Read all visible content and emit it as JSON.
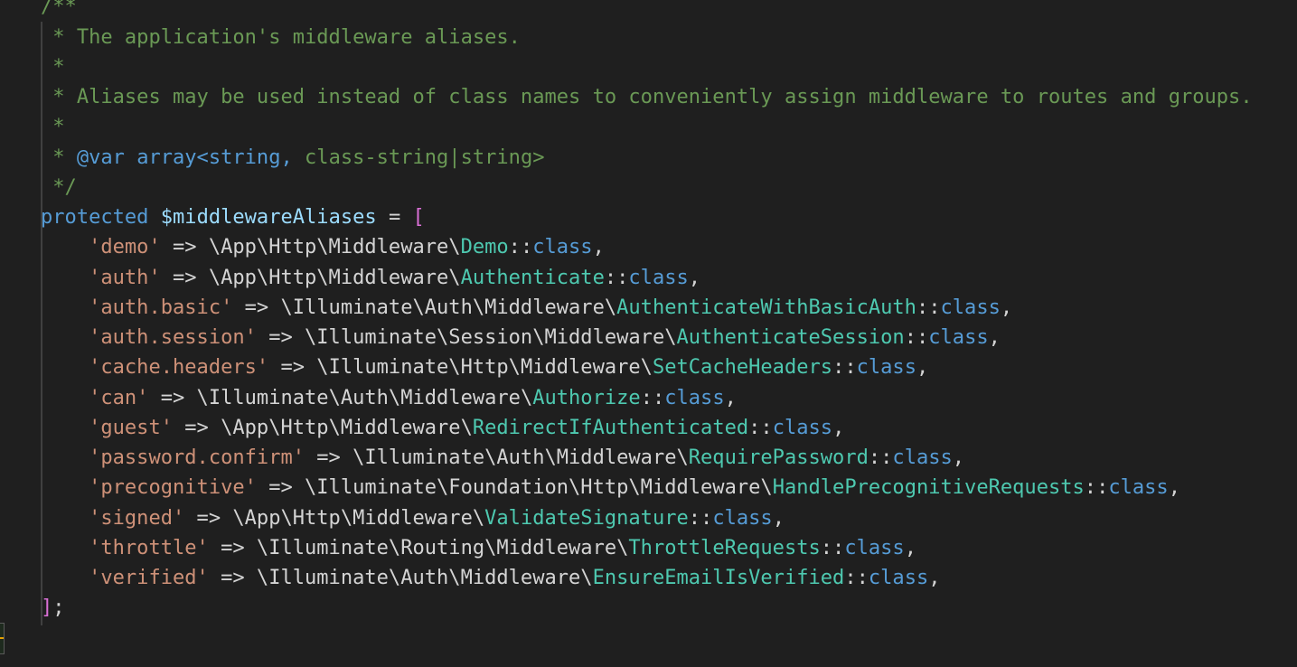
{
  "editor": {
    "lines": [
      {
        "tokens": [
          {
            "t": "/**",
            "c": "comment"
          }
        ]
      },
      {
        "tokens": [
          {
            "t": " * The application's middleware aliases.",
            "c": "comment"
          }
        ]
      },
      {
        "tokens": [
          {
            "t": " *",
            "c": "comment"
          }
        ]
      },
      {
        "tokens": [
          {
            "t": " * Aliases may be used instead of class names to conveniently assign middleware to routes and groups.",
            "c": "comment"
          }
        ]
      },
      {
        "tokens": [
          {
            "t": " *",
            "c": "comment"
          }
        ]
      },
      {
        "tokens": [
          {
            "t": " * ",
            "c": "comment"
          },
          {
            "t": "@var array<string,",
            "c": "doctag"
          },
          {
            "t": " class-string|string>",
            "c": "comment"
          }
        ]
      },
      {
        "tokens": [
          {
            "t": " */",
            "c": "comment"
          }
        ]
      },
      {
        "tokens": [
          {
            "t": "protected",
            "c": "keyword"
          },
          {
            "t": " ",
            "c": "plain"
          },
          {
            "t": "$middlewareAliases",
            "c": "variable"
          },
          {
            "t": " = ",
            "c": "operator"
          },
          {
            "t": "[",
            "c": "bracket"
          }
        ]
      },
      {
        "tokens": [
          {
            "t": "    'demo'",
            "c": "string"
          },
          {
            "t": " => \\App\\Http\\Middleware\\",
            "c": "namespace"
          },
          {
            "t": "Demo",
            "c": "classname"
          },
          {
            "t": "::",
            "c": "plain"
          },
          {
            "t": "class",
            "c": "classkw"
          },
          {
            "t": ",",
            "c": "plain"
          }
        ]
      },
      {
        "tokens": [
          {
            "t": "    'auth'",
            "c": "string"
          },
          {
            "t": " => \\App\\Http\\Middleware\\",
            "c": "namespace"
          },
          {
            "t": "Authenticate",
            "c": "classname"
          },
          {
            "t": "::",
            "c": "plain"
          },
          {
            "t": "class",
            "c": "classkw"
          },
          {
            "t": ",",
            "c": "plain"
          }
        ]
      },
      {
        "tokens": [
          {
            "t": "    'auth.basic'",
            "c": "string"
          },
          {
            "t": " => \\Illuminate\\Auth\\Middleware\\",
            "c": "namespace"
          },
          {
            "t": "AuthenticateWithBasicAuth",
            "c": "classname"
          },
          {
            "t": "::",
            "c": "plain"
          },
          {
            "t": "class",
            "c": "classkw"
          },
          {
            "t": ",",
            "c": "plain"
          }
        ]
      },
      {
        "tokens": [
          {
            "t": "    'auth.session'",
            "c": "string"
          },
          {
            "t": " => \\Illuminate\\Session\\Middleware\\",
            "c": "namespace"
          },
          {
            "t": "AuthenticateSession",
            "c": "classname"
          },
          {
            "t": "::",
            "c": "plain"
          },
          {
            "t": "class",
            "c": "classkw"
          },
          {
            "t": ",",
            "c": "plain"
          }
        ]
      },
      {
        "tokens": [
          {
            "t": "    'cache.headers'",
            "c": "string"
          },
          {
            "t": " => \\Illuminate\\Http\\Middleware\\",
            "c": "namespace"
          },
          {
            "t": "SetCacheHeaders",
            "c": "classname"
          },
          {
            "t": "::",
            "c": "plain"
          },
          {
            "t": "class",
            "c": "classkw"
          },
          {
            "t": ",",
            "c": "plain"
          }
        ]
      },
      {
        "tokens": [
          {
            "t": "    'can'",
            "c": "string"
          },
          {
            "t": " => \\Illuminate\\Auth\\Middleware\\",
            "c": "namespace"
          },
          {
            "t": "Authorize",
            "c": "classname"
          },
          {
            "t": "::",
            "c": "plain"
          },
          {
            "t": "class",
            "c": "classkw"
          },
          {
            "t": ",",
            "c": "plain"
          }
        ]
      },
      {
        "tokens": [
          {
            "t": "    'guest'",
            "c": "string"
          },
          {
            "t": " => \\App\\Http\\Middleware\\",
            "c": "namespace"
          },
          {
            "t": "RedirectIfAuthenticated",
            "c": "classname"
          },
          {
            "t": "::",
            "c": "plain"
          },
          {
            "t": "class",
            "c": "classkw"
          },
          {
            "t": ",",
            "c": "plain"
          }
        ]
      },
      {
        "tokens": [
          {
            "t": "    'password.confirm'",
            "c": "string"
          },
          {
            "t": " => \\Illuminate\\Auth\\Middleware\\",
            "c": "namespace"
          },
          {
            "t": "RequirePassword",
            "c": "classname"
          },
          {
            "t": "::",
            "c": "plain"
          },
          {
            "t": "class",
            "c": "classkw"
          },
          {
            "t": ",",
            "c": "plain"
          }
        ]
      },
      {
        "tokens": [
          {
            "t": "    'precognitive'",
            "c": "string"
          },
          {
            "t": " => \\Illuminate\\Foundation\\Http\\Middleware\\",
            "c": "namespace"
          },
          {
            "t": "HandlePrecognitiveRequests",
            "c": "classname"
          },
          {
            "t": "::",
            "c": "plain"
          },
          {
            "t": "class",
            "c": "classkw"
          },
          {
            "t": ",",
            "c": "plain"
          }
        ]
      },
      {
        "tokens": [
          {
            "t": "    'signed'",
            "c": "string"
          },
          {
            "t": " => \\App\\Http\\Middleware\\",
            "c": "namespace"
          },
          {
            "t": "ValidateSignature",
            "c": "classname"
          },
          {
            "t": "::",
            "c": "plain"
          },
          {
            "t": "class",
            "c": "classkw"
          },
          {
            "t": ",",
            "c": "plain"
          }
        ]
      },
      {
        "tokens": [
          {
            "t": "    'throttle'",
            "c": "string"
          },
          {
            "t": " => \\Illuminate\\Routing\\Middleware\\",
            "c": "namespace"
          },
          {
            "t": "ThrottleRequests",
            "c": "classname"
          },
          {
            "t": "::",
            "c": "plain"
          },
          {
            "t": "class",
            "c": "classkw"
          },
          {
            "t": ",",
            "c": "plain"
          }
        ]
      },
      {
        "tokens": [
          {
            "t": "    'verified'",
            "c": "string"
          },
          {
            "t": " => \\Illuminate\\Auth\\Middleware\\",
            "c": "namespace"
          },
          {
            "t": "EnsureEmailIsVerified",
            "c": "classname"
          },
          {
            "t": "::",
            "c": "plain"
          },
          {
            "t": "class",
            "c": "classkw"
          },
          {
            "t": ",",
            "c": "plain"
          }
        ]
      },
      {
        "tokens": [
          {
            "t": "]",
            "c": "bracket"
          },
          {
            "t": ";",
            "c": "plain"
          }
        ]
      },
      {
        "tokens": []
      }
    ]
  },
  "colors": {
    "background": "#1f1f1f",
    "comment": "#6a9955",
    "keyword": "#569cd6",
    "variable": "#9cdcfe",
    "string": "#ce9178",
    "classname": "#4ec9b0",
    "bracket": "#da70d6"
  }
}
